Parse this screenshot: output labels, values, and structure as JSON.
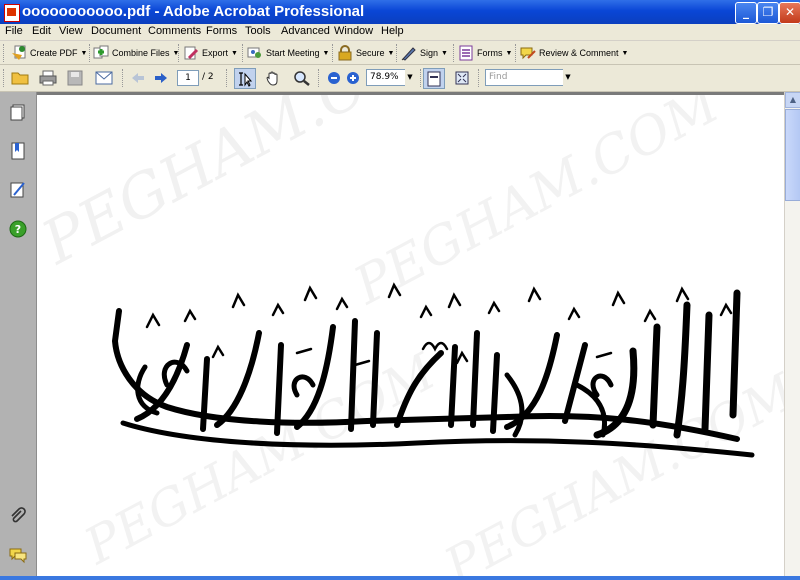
{
  "window": {
    "title": "ooooooooooo.pdf - Adobe Acrobat Professional",
    "minimize": "_",
    "restore": "❐",
    "close": "✕"
  },
  "menu": [
    "File",
    "Edit",
    "View",
    "Document",
    "Comments",
    "Forms",
    "Tools",
    "Advanced",
    "Window",
    "Help"
  ],
  "toolbar1": {
    "create_pdf": "Create PDF",
    "combine_files": "Combine Files",
    "export": "Export",
    "start_meeting": "Start Meeting",
    "secure": "Secure",
    "sign": "Sign",
    "forms": "Forms",
    "review_comment": "Review & Comment"
  },
  "toolbar2": {
    "current_page": "1",
    "page_separator": "/",
    "page_count": "2",
    "zoom_level": "78.9%",
    "find_placeholder": "Find"
  },
  "document": {
    "calligraphy": "إن الدين عند الله الإسلام",
    "watermark": "PEGHAM.COM"
  },
  "colors": {
    "title_bar": "#0a46d6",
    "panel": "#b2b2b2",
    "page": "#ffffff"
  }
}
